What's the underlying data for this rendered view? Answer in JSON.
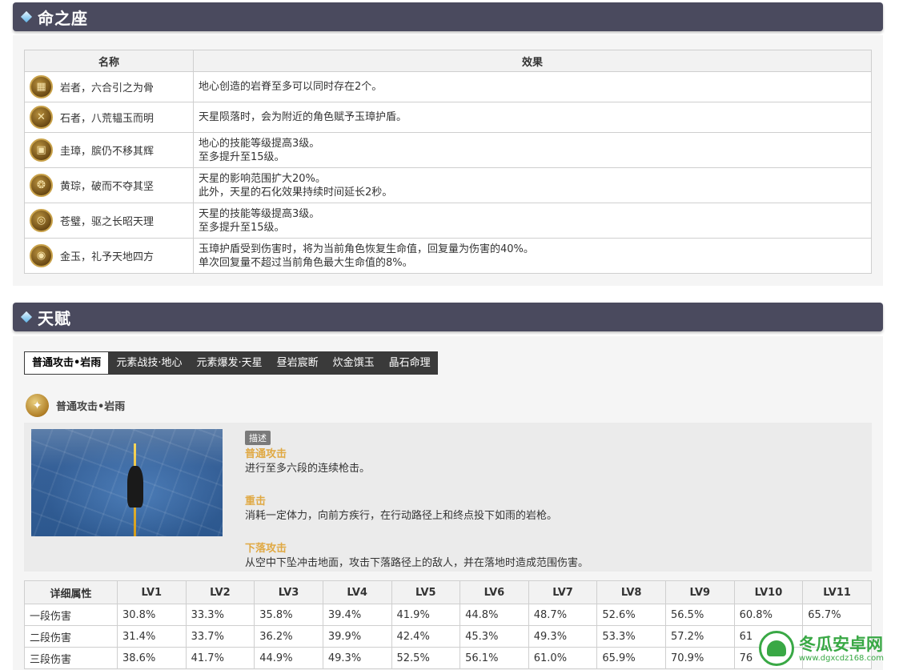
{
  "section1": {
    "title": "命之座"
  },
  "constellation": {
    "headers": [
      "名称",
      "效果"
    ],
    "rows": [
      {
        "icon": "grid-icon",
        "name": "岩者，六合引之为骨",
        "effect": [
          "地心创造的岩脊至多可以同时存在2个。"
        ]
      },
      {
        "icon": "swords-icon",
        "name": "石者，八荒韫玉而明",
        "effect": [
          "天星陨落时，会为附近的角色赋予玉璋护盾。"
        ]
      },
      {
        "icon": "tablet-icon",
        "name": "圭璋，膑仍不移其辉",
        "effect": [
          "地心的技能等级提高3级。",
          "至多提升至15级。"
        ]
      },
      {
        "icon": "dragon-icon",
        "name": "黄琮，破而不夺其坚",
        "effect": [
          "天星的影响范围扩大20%。",
          "此外，天星的石化效果持续时间延长2秒。"
        ]
      },
      {
        "icon": "ring-icon",
        "name": "苍璧，驱之长昭天理",
        "effect": [
          "天星的技能等级提高3级。",
          "至多提升至15级。"
        ]
      },
      {
        "icon": "jade-icon",
        "name": "金玉，礼予天地四方",
        "effect": [
          "玉璋护盾受到伤害时，将为当前角色恢复生命值，回复量为伤害的40%。",
          "单次回复量不超过当前角色最大生命值的8%。"
        ]
      }
    ]
  },
  "section2": {
    "title": "天赋"
  },
  "tabs": [
    "普通攻击•岩雨",
    "元素战技·地心",
    "元素爆发·天星",
    "昼岩宸断",
    "炊金馔玉",
    "晶石命理"
  ],
  "skill": {
    "title": "普通攻击•岩雨",
    "tag": "描述",
    "blocks": [
      {
        "heading": "普通攻击",
        "text": "进行至多六段的连续枪击。"
      },
      {
        "heading": "重击",
        "text": "消耗一定体力，向前方疾行，在行动路径上和终点投下如雨的岩枪。"
      },
      {
        "heading": "下落攻击",
        "text": "从空中下坠冲击地面，攻击下落路径上的敌人，并在落地时造成范围伤害。"
      }
    ]
  },
  "attrs": {
    "headers": [
      "详细属性",
      "LV1",
      "LV2",
      "LV3",
      "LV4",
      "LV5",
      "LV6",
      "LV7",
      "LV8",
      "LV9",
      "LV10",
      "LV11"
    ],
    "rows": [
      [
        "一段伤害",
        "30.8%",
        "33.3%",
        "35.8%",
        "39.4%",
        "41.9%",
        "44.8%",
        "48.7%",
        "52.6%",
        "56.5%",
        "60.8%",
        "65.7%"
      ],
      [
        "二段伤害",
        "31.4%",
        "33.7%",
        "36.2%",
        "39.9%",
        "42.4%",
        "45.3%",
        "49.3%",
        "53.3%",
        "57.2%",
        "61",
        ""
      ],
      [
        "三段伤害",
        "38.6%",
        "41.7%",
        "44.9%",
        "49.3%",
        "52.5%",
        "56.1%",
        "61.0%",
        "65.9%",
        "70.9%",
        "76",
        ""
      ]
    ]
  },
  "watermark": {
    "name": "冬瓜安卓网",
    "url": "www.dgxcdz168.com"
  }
}
